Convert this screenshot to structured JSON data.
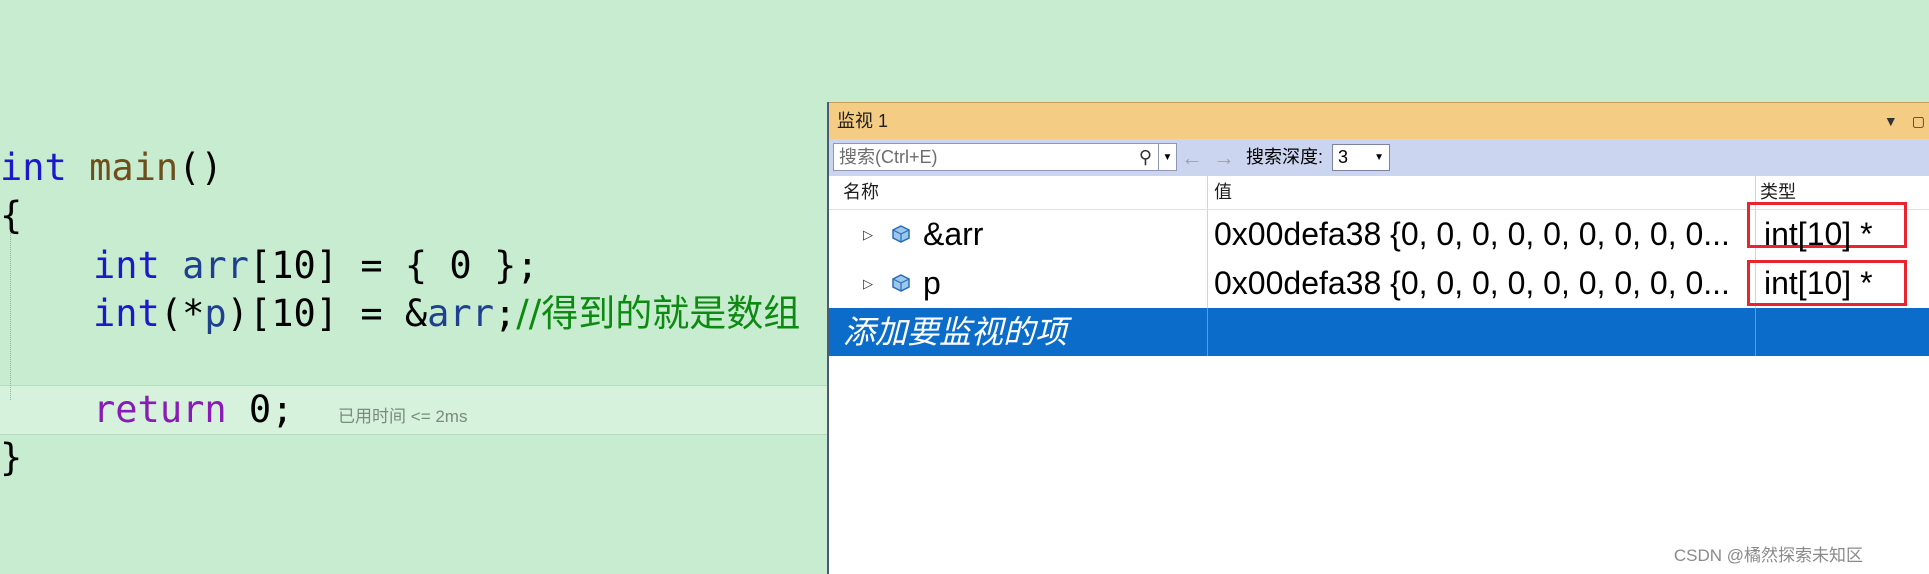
{
  "editor": {
    "line1": {
      "kw": "int",
      "fn": "main",
      "rest": "()"
    },
    "line2": "{",
    "line3": {
      "kw": "int",
      "var": "arr",
      "rest": "[10] = { 0 };"
    },
    "line4": {
      "kw": "int",
      "open": "(*",
      "var": "p",
      "close": ")[10] = &",
      "var2": "arr",
      "semi": ";",
      "comment": "//得到的就是数组"
    },
    "line6": {
      "kw": "return",
      "rest": " 0;",
      "elapsed": "已用时间 <= 2ms"
    },
    "line7": "}"
  },
  "watch": {
    "title": "监视 1",
    "search_placeholder": "搜索(Ctrl+E)",
    "depth_label": "搜索深度:",
    "depth_value": "3",
    "headers": {
      "name": "名称",
      "value": "值",
      "type": "类型"
    },
    "rows": [
      {
        "name": "&arr",
        "value": "0x00defa38 {0, 0, 0, 0, 0, 0, 0, 0, 0...",
        "type": "int[10] *"
      },
      {
        "name": "p",
        "value": "0x00defa38 {0, 0, 0, 0, 0, 0, 0, 0, 0...",
        "type": "int[10] *"
      }
    ],
    "add_item": "添加要监视的项"
  },
  "watermark": "CSDN @橘然探索未知区",
  "colors": {
    "highlight": "#e8242f",
    "selection": "#0b6cc9",
    "title_bar": "#f5cc84"
  }
}
